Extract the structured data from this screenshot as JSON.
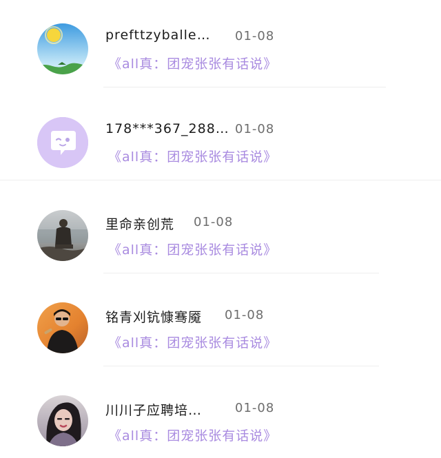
{
  "conversations": [
    {
      "name": "prefttzyballe…",
      "date": "01-08",
      "message": "《all真：团宠张张有话说》",
      "avatar_icon": "sunny-landscape-avatar-icon"
    },
    {
      "name": "178***367_288…",
      "date": "01-08",
      "message": "《all真：团宠张张有话说》",
      "avatar_icon": "speech-bubble-face-avatar-icon"
    },
    {
      "name": "里命亲创荒",
      "date": "01-08",
      "message": "《all真：团宠张张有话说》",
      "avatar_icon": "person-by-sea-avatar-icon"
    },
    {
      "name": "铭青刈钪慷骞魇",
      "date": "01-08",
      "message": "《all真：团宠张张有话说》",
      "avatar_icon": "man-with-sunglasses-avatar-icon"
    },
    {
      "name": "川川子应聘培…",
      "date": "01-08",
      "message": "《all真：团宠张张有话说》",
      "avatar_icon": "woman-portrait-avatar-icon"
    }
  ],
  "colors": {
    "message": "#a98be0",
    "name": "#1b1b1b",
    "date": "#6d6d6d",
    "divider": "#eeeeee",
    "bubble_avatar_bg": "#d8c6f6"
  }
}
